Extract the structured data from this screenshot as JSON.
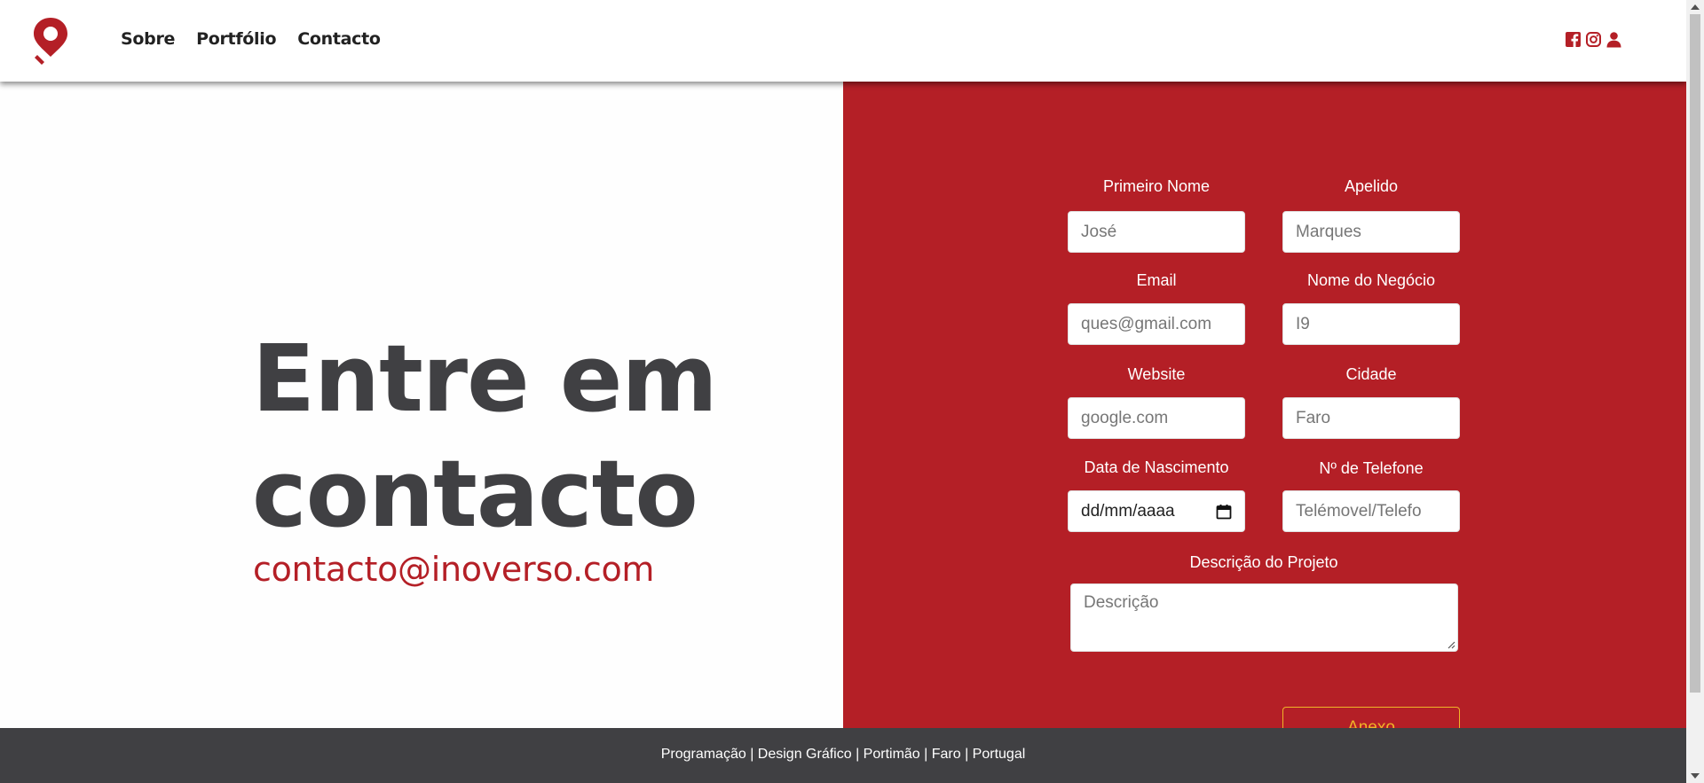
{
  "nav": {
    "logo_icon": "map-pin-logo-icon",
    "links": [
      "Sobre",
      "Portfólio",
      "Contacto"
    ],
    "social_icons": [
      "facebook-icon",
      "instagram-icon",
      "user-icon"
    ]
  },
  "hero": {
    "title_line1": "Entre em",
    "title_line2": "contacto",
    "email": "contacto@inoverso.com"
  },
  "form": {
    "first_name": {
      "label": "Primeiro Nome",
      "placeholder": "José"
    },
    "last_name": {
      "label": "Apelido",
      "placeholder": "Marques"
    },
    "email": {
      "label": "Email",
      "placeholder": "ques@gmail.com"
    },
    "business": {
      "label": "Nome do Negócio",
      "placeholder": "I9"
    },
    "website": {
      "label": "Website",
      "placeholder": "google.com"
    },
    "city": {
      "label": "Cidade",
      "placeholder": "Faro"
    },
    "birthdate": {
      "label": "Data de Nascimento",
      "value": "dd/mm/aaaa"
    },
    "phone": {
      "label": "Nº de Telefone",
      "placeholder": "Telémovel/Telefo"
    },
    "description": {
      "label": "Descrição do Projeto",
      "placeholder": "Descrição"
    },
    "annex_label": "Anexo"
  },
  "footer": {
    "text": "Programação | Design Gráfico | Portimão | Faro | Portugal"
  },
  "colors": {
    "brand_red": "#b41f26",
    "dark_gray": "#404043",
    "accent_gold": "#f0b428"
  }
}
